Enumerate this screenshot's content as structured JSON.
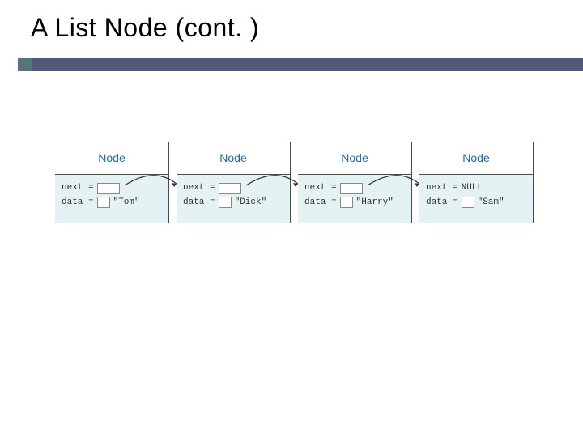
{
  "title": "A List Node (cont. )",
  "node_label": "Node",
  "fields": {
    "next": "next =",
    "data": "data ="
  },
  "null_text": "NULL",
  "nodes": [
    {
      "data_value": "\"Tom\"",
      "next_is_null": false
    },
    {
      "data_value": "\"Dick\"",
      "next_is_null": false
    },
    {
      "data_value": "\"Harry\"",
      "next_is_null": false
    },
    {
      "data_value": "\"Sam\"",
      "next_is_null": true
    }
  ]
}
